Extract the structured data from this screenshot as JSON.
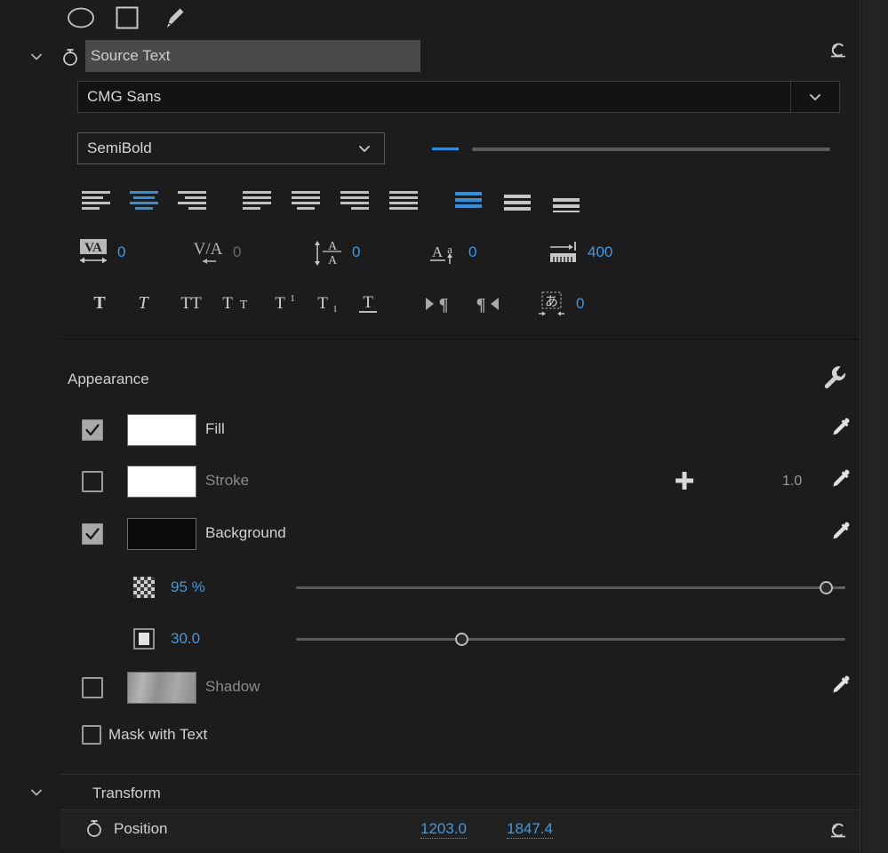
{
  "tools": [
    {
      "name": "ellipse-tool",
      "label": "Ellipse Tool"
    },
    {
      "name": "rectangle-tool",
      "label": "Rectangle Tool"
    },
    {
      "name": "pen-tool",
      "label": "Pen Tool"
    }
  ],
  "source_text": {
    "label": "Source Text",
    "expanded": true,
    "stopwatch": "stopwatch-icon",
    "reset": "reset-icon"
  },
  "font": {
    "family": "CMG Sans",
    "style": "SemiBold",
    "size_value": "",
    "size_slider_pct": 0
  },
  "align": {
    "paragraph": [
      {
        "name": "align-left",
        "active": false
      },
      {
        "name": "align-center",
        "active": true
      },
      {
        "name": "align-right",
        "active": false
      },
      {
        "name": "justify-last-left",
        "active": false
      },
      {
        "name": "justify-last-center",
        "active": false
      },
      {
        "name": "justify-last-right",
        "active": false
      },
      {
        "name": "justify-all",
        "active": false
      }
    ],
    "vertical": [
      {
        "name": "vertical-align-top",
        "active": true
      },
      {
        "name": "vertical-align-center",
        "active": false
      },
      {
        "name": "vertical-align-bottom",
        "active": false
      }
    ]
  },
  "metrics": [
    {
      "name": "tracking",
      "icon": "tracking-icon",
      "value": "0",
      "dim": false,
      "selected": true
    },
    {
      "name": "kerning",
      "icon": "kerning-icon",
      "value": "0",
      "dim": true,
      "selected": false
    },
    {
      "name": "leading",
      "icon": "leading-icon",
      "value": "0",
      "dim": false,
      "selected": false
    },
    {
      "name": "baseline-shift",
      "icon": "baseline-shift-icon",
      "value": "0",
      "dim": false,
      "selected": false
    },
    {
      "name": "tab-width",
      "icon": "tab-width-icon",
      "value": "400",
      "dim": false,
      "selected": false
    }
  ],
  "text_styles": [
    {
      "name": "faux-bold",
      "glyph": "T",
      "active": false
    },
    {
      "name": "faux-italic",
      "glyph": "T",
      "active": false
    },
    {
      "name": "all-caps",
      "glyph": "TT",
      "active": false
    },
    {
      "name": "small-caps",
      "glyph": "Tт",
      "active": false
    },
    {
      "name": "superscript",
      "glyph": "T¹",
      "active": false
    },
    {
      "name": "subscript",
      "glyph": "T₁",
      "active": false
    },
    {
      "name": "underline",
      "glyph": "T",
      "active": false
    },
    {
      "name": "paragraph-ltr",
      "glyph": "▶¶",
      "active": false
    },
    {
      "name": "paragraph-rtl",
      "glyph": "¶◀",
      "active": false
    }
  ],
  "tsume": {
    "name": "tsume",
    "glyph": "あ",
    "value": "0"
  },
  "appearance": {
    "title": "Appearance",
    "wrench": "wrench-icon",
    "rows": [
      {
        "name": "fill",
        "label": "Fill",
        "checked": true,
        "swatch": "#ffffff",
        "dim": false
      },
      {
        "name": "stroke",
        "label": "Stroke",
        "checked": false,
        "swatch": "#ffffff",
        "dim": true,
        "width": "1.0",
        "add": "+"
      },
      {
        "name": "background",
        "label": "Background",
        "checked": true,
        "swatch": "#0a0a0a",
        "dim": false
      },
      {
        "name": "shadow",
        "label": "Shadow",
        "checked": false,
        "swatch": "#8f8f8f",
        "dim": true
      }
    ],
    "sliders": [
      {
        "name": "background-opacity",
        "icon": "checkerboard-icon",
        "value": "95 %",
        "pct": 96
      },
      {
        "name": "background-corner-radius",
        "icon": "corner-radius-icon",
        "value": "30.0",
        "pct": 30
      }
    ],
    "mask_with_text": {
      "label": "Mask with Text",
      "checked": false
    }
  },
  "transform": {
    "title": "Transform",
    "expanded": true,
    "position": {
      "label": "Position",
      "x": "1203.0",
      "y": "1847.4",
      "stopwatch": "stopwatch-icon",
      "reset": "reset-icon"
    }
  },
  "colors": {
    "accent": "#3d9ae8",
    "panel_bg": "#1c1c1c",
    "field_bg": "#131313",
    "highlight_bg": "#4a4a4a"
  }
}
